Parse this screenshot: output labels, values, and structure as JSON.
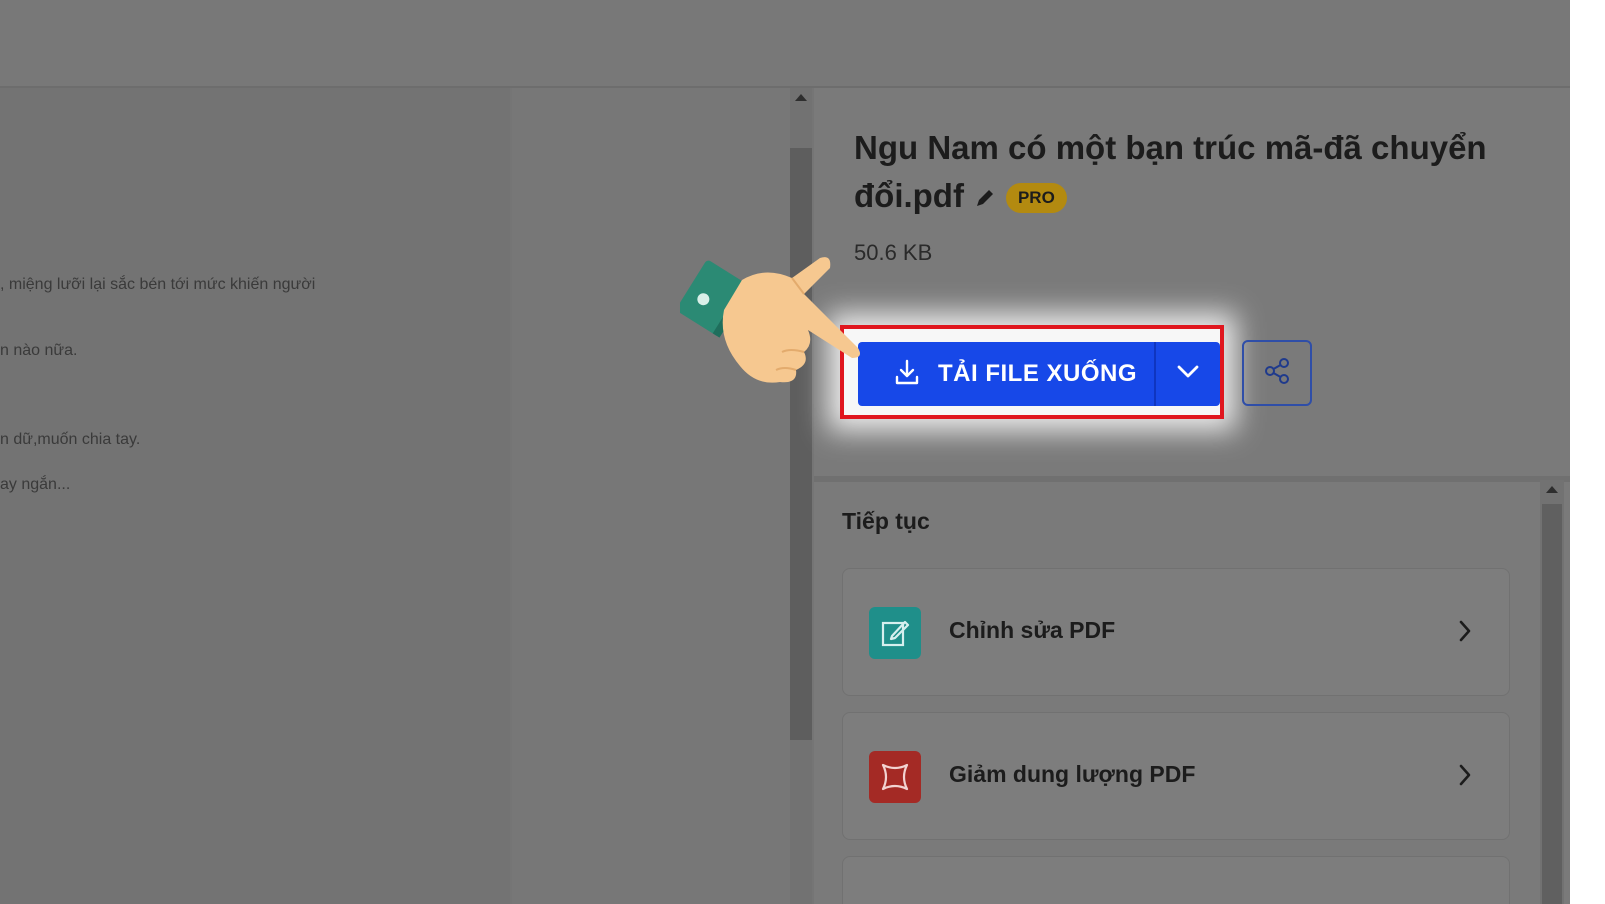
{
  "document_preview": {
    "lines": [
      ", miệng lưỡi lại sắc bén tới mức khiến người",
      "n nào nữa.",
      "n dữ,muốn chia tay.",
      "ay ngắn..."
    ]
  },
  "file": {
    "title": "Ngu Nam có một bạn trúc mã-đã chuyển đổi.pdf",
    "badge": "PRO",
    "size": "50.6 KB"
  },
  "actions": {
    "download_label": "TẢI FILE XUỐNG",
    "download_icon": "download-icon",
    "dropdown_icon": "chevron-down-icon",
    "share_icon": "share-icon"
  },
  "continue_section": {
    "title": "Tiếp tục",
    "items": [
      {
        "label": "Chỉnh sửa PDF",
        "icon": "edit-pdf-icon",
        "color": "#1f8f8a"
      },
      {
        "label": "Giảm dung lượng PDF",
        "icon": "compress-pdf-icon",
        "color": "#a42a25"
      }
    ]
  },
  "colors": {
    "primary": "#1748e8",
    "highlight_border": "#e0161e",
    "overlay": "#757575"
  }
}
